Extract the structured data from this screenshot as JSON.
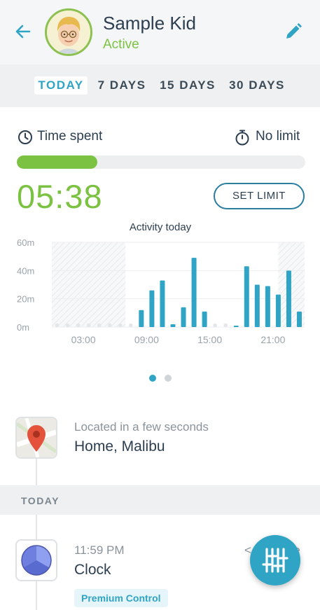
{
  "header": {
    "back_icon": "arrow-left-icon",
    "avatar_icon": "kid-avatar",
    "name": "Sample Kid",
    "status": "Active",
    "edit_icon": "pencil-icon",
    "accent": "#7cc242"
  },
  "tabs": [
    {
      "label": "TODAY",
      "active": true
    },
    {
      "label": "7 DAYS",
      "active": false
    },
    {
      "label": "15 DAYS",
      "active": false
    },
    {
      "label": "30 DAYS",
      "active": false
    }
  ],
  "usage": {
    "time_spent_icon": "clock-icon",
    "time_spent_label": "Time spent",
    "limit_icon": "stopwatch-icon",
    "limit_label": "No limit",
    "progress_fraction": 0.28,
    "time_value": "05:38",
    "set_limit_label": "SET LIMIT"
  },
  "chart_data": {
    "type": "bar",
    "title": "Activity today",
    "y_ticks": [
      "60m",
      "40m",
      "20m",
      "0m"
    ],
    "x_ticks": [
      "03:00",
      "09:00",
      "15:00",
      "21:00"
    ],
    "ylim": [
      0,
      60
    ],
    "bar_color": "#2fa4c4",
    "zero_dot_color": "#e4e7e9",
    "restricted_ranges_hours": [
      [
        0,
        7
      ],
      [
        21.5,
        24
      ]
    ],
    "x_hours": [
      0.5,
      1.5,
      2.5,
      3.5,
      4.5,
      5.5,
      6.5,
      7.5,
      8.5,
      9.5,
      10.5,
      11.5,
      12.5,
      13.5,
      14.5,
      15.5,
      16.5,
      17.5,
      18.5,
      19.5,
      20.5,
      21.5,
      22.5,
      23.5
    ],
    "values": [
      0,
      0,
      0,
      0,
      0,
      0,
      0,
      0,
      12,
      26,
      33,
      2,
      14,
      49,
      11,
      0,
      0,
      1,
      43,
      30,
      29,
      23,
      40,
      11
    ]
  },
  "pager": {
    "count": 2,
    "active": 0
  },
  "location": {
    "icon": "map-pin-icon",
    "subtitle": "Located in a few seconds",
    "place": "Home, Malibu"
  },
  "section_today": "TODAY",
  "activity": {
    "icon": "clock-app-icon",
    "time": "11:59 PM",
    "app": "Clock",
    "badge": "Premium Control",
    "partially_hidden_text": "< 1 minute"
  },
  "fab": {
    "icon": "sliders-icon"
  }
}
